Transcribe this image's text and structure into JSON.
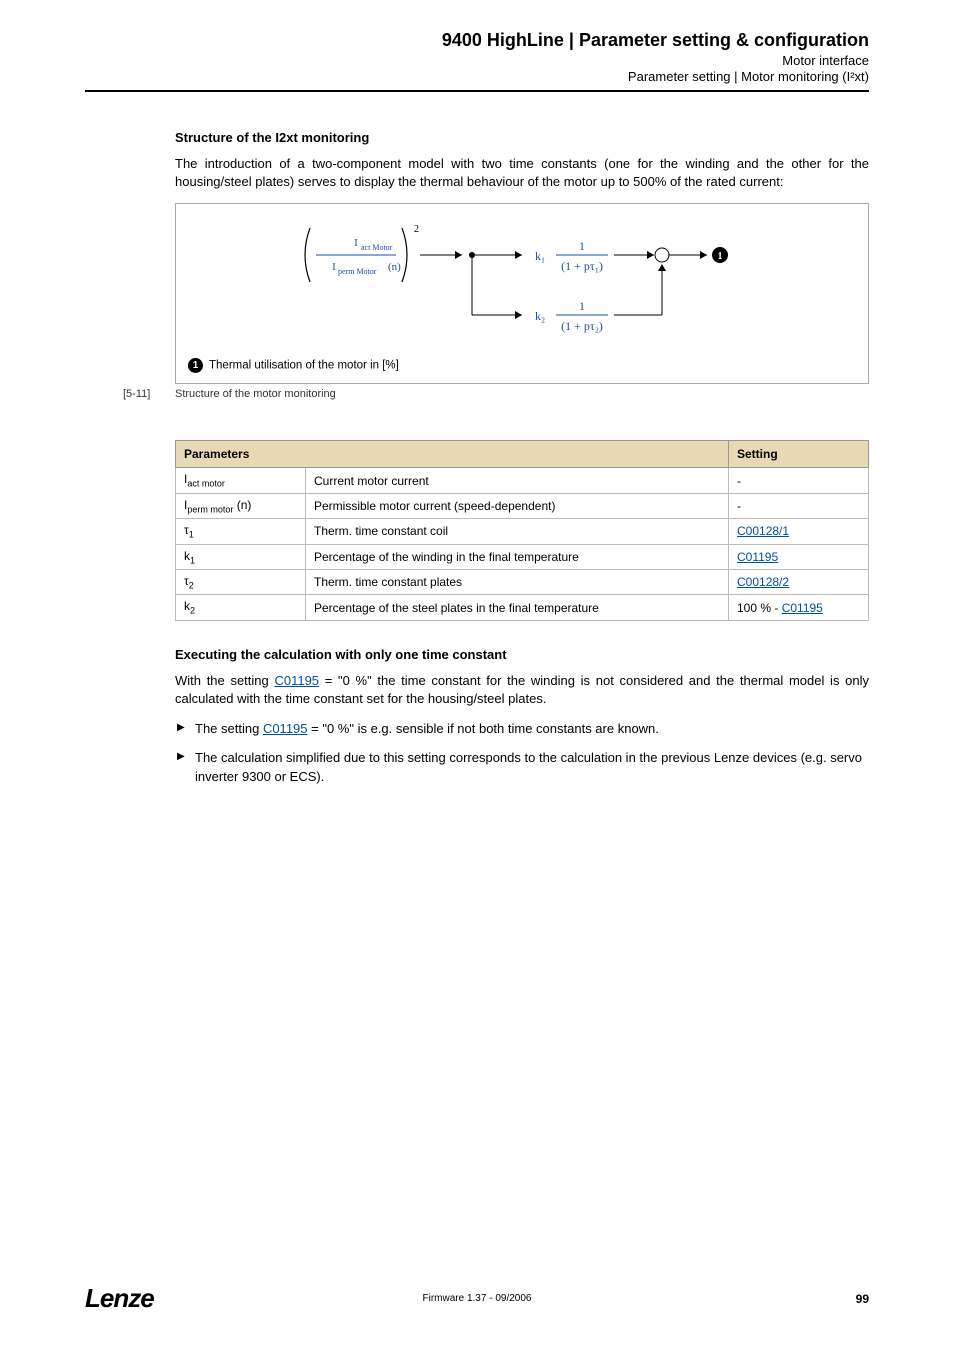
{
  "header": {
    "title": "9400 HighLine | Parameter setting & configuration",
    "sub1": "Motor interface",
    "sub2": "Parameter setting | Motor monitoring (I²xt)"
  },
  "section1": {
    "heading": "Structure of the I2xt monitoring",
    "para": "The introduction of a two-component model with two time constants (one for the winding and the other for the housing/steel plates) serves to display the thermal behaviour of the motor up to 500% of the rated current:"
  },
  "diagram": {
    "fraction_top": "Iact Motor",
    "fraction_bottom": "Iperm Motor (n)",
    "exponent": "2",
    "k1": "k₁",
    "k2": "k₂",
    "tf1_num": "1",
    "tf1_den": "(1 + pτ₁)",
    "tf2_num": "1",
    "tf2_den": "(1 + pτ₂)",
    "marker": "1",
    "caption": "Thermal utilisation of the motor in [%]"
  },
  "figure": {
    "num": "[5-11]",
    "text": "Structure of the motor monitoring"
  },
  "table": {
    "hParams": "Parameters",
    "hSetting": "Setting",
    "rows": [
      {
        "sym": "I",
        "sub": "act motor",
        "desc": "Current motor current",
        "setting": "-",
        "link": false
      },
      {
        "sym": "I",
        "sub": "perm motor",
        "suffix": " (n)",
        "desc": "Permissible motor current (speed-dependent)",
        "setting": "-",
        "link": false
      },
      {
        "sym": "τ",
        "sub": "1",
        "desc": "Therm. time constant coil",
        "setting": "C00128/1",
        "link": true
      },
      {
        "sym": "k",
        "sub": "1",
        "desc": "Percentage of the winding in the final temperature",
        "setting": "C01195",
        "link": true
      },
      {
        "sym": "τ",
        "sub": "2",
        "desc": "Therm. time constant plates",
        "setting": "C00128/2",
        "link": true
      },
      {
        "sym": "k",
        "sub": "2",
        "desc": "Percentage of the steel plates in the final temperature",
        "setting_prefix": "100 % - ",
        "setting": "C01195",
        "link": true
      }
    ]
  },
  "section2": {
    "heading": "Executing the calculation with only one time constant",
    "para_pre": "With the setting  ",
    "para_link": "C01195",
    "para_post": " = \"0 %\" the time constant for the winding is not considered and the thermal model is only calculated with the time constant set for the housing/steel plates.",
    "bullets": [
      {
        "pre": "The setting ",
        "link": "C01195",
        "post": " = \"0 %\" is e.g. sensible if not both time constants are known."
      },
      {
        "pre": "The calculation simplified due to this setting corresponds to the calculation in the previous Lenze devices (e.g. servo inverter 9300 or ECS).",
        "link": null,
        "post": ""
      }
    ]
  },
  "footer": {
    "logo": "Lenze",
    "center": "Firmware 1.37 - 09/2006",
    "page": "99"
  }
}
